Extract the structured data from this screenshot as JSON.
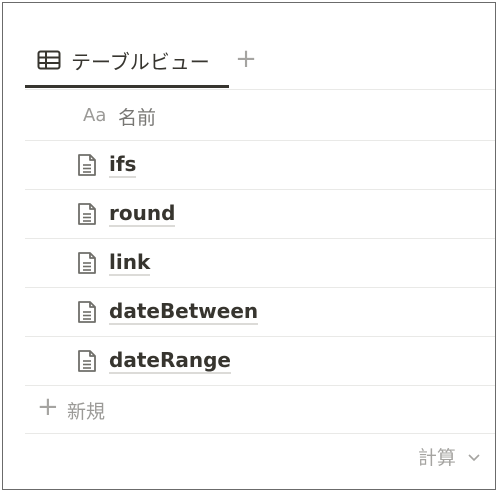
{
  "view_tabs": {
    "active_tab": {
      "label": "テーブルビュー",
      "icon": "table-icon"
    },
    "add_view_label": "+"
  },
  "table": {
    "header": {
      "type_icon_label": "Aa",
      "name_label": "名前"
    },
    "rows": [
      {
        "title": "ifs",
        "icon": "page-icon"
      },
      {
        "title": "round",
        "icon": "page-icon"
      },
      {
        "title": "link",
        "icon": "page-icon"
      },
      {
        "title": "dateBetween",
        "icon": "page-icon"
      },
      {
        "title": "dateRange",
        "icon": "page-icon"
      }
    ],
    "new_row": {
      "plus": "+",
      "label": "新規"
    },
    "calculate": {
      "label": "計算",
      "icon": "chevron-down-icon"
    }
  },
  "colors": {
    "text": "#37352f",
    "muted": "#9b9a97",
    "divider": "#e9e9e7",
    "border": "#6b6b6b"
  }
}
